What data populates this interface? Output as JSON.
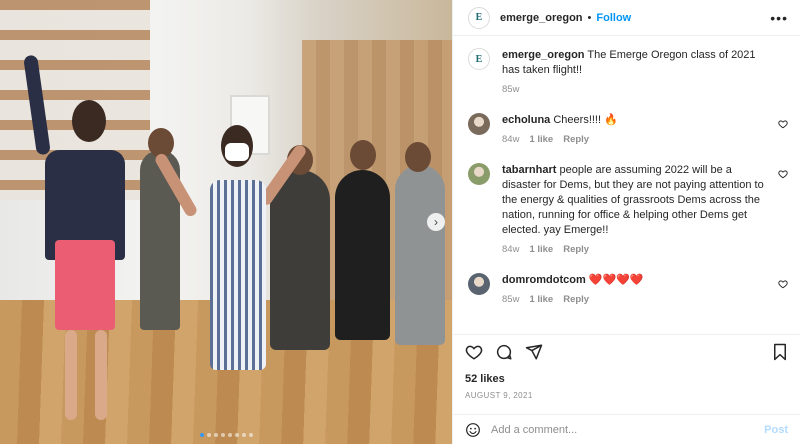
{
  "post": {
    "username": "emerge_oregon",
    "avatar_letter": "E",
    "follow_label": "Follow",
    "separator": "•",
    "more_icon": "more-horizontal-icon",
    "caption": {
      "username": "emerge_oregon",
      "text": "The Emerge Oregon class of 2021 has taken flight!!",
      "time": "85w"
    },
    "carousel": {
      "total_slides": 8,
      "active_index": 0,
      "next_icon": "chevron-right-icon"
    }
  },
  "comments": [
    {
      "username": "echoluna",
      "text": "Cheers!!!! 🔥",
      "time": "84w",
      "likes": "1 like",
      "reply_label": "Reply",
      "avatar_color": "#7a6a5c"
    },
    {
      "username": "tabarnhart",
      "text": "people are assuming 2022 will be a disaster for Dems, but they are not paying attention to the energy & qualities of grassroots Dems across the nation, running for office & helping other Dems get elected. yay Emerge!!",
      "time": "84w",
      "likes": "1 like",
      "reply_label": "Reply",
      "avatar_color": "#8a9c6a"
    },
    {
      "username": "domromdotcom",
      "text": "❤️❤️❤️❤️",
      "time": "85w",
      "likes": "1 like",
      "reply_label": "Reply",
      "avatar_color": "#5a6470"
    }
  ],
  "actions": {
    "likes": "52 likes",
    "date": "AUGUST 9, 2021"
  },
  "add_comment": {
    "placeholder": "Add a comment...",
    "post_label": "Post"
  },
  "colors": {
    "accent": "#0095f6",
    "brand": "#1b6b73"
  }
}
